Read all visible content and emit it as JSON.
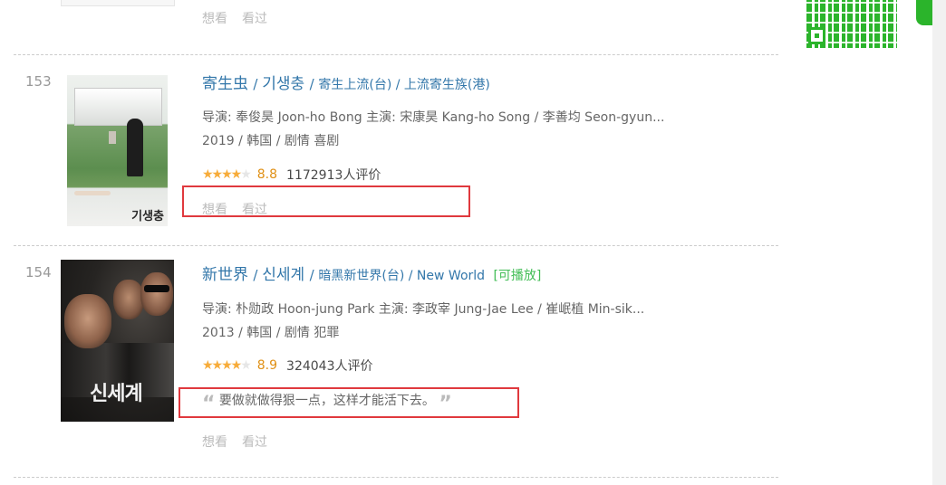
{
  "top_item": {
    "actions": [
      "想看",
      "看过"
    ]
  },
  "movies": [
    {
      "rank": "153",
      "title": "寄生虫",
      "original_title": "기생충",
      "other_titles": "寄生上流(台) / 上流寄生族(港)",
      "director_cast": "导演: 奉俊昊 Joon-ho Bong   主演: 宋康昊 Kang-ho Song / 李善均 Seon-gyun...",
      "year_region_genre": "2019 / 韩国 / 剧情 喜剧",
      "rating": "8.8",
      "rating_fraction": 0.88,
      "votes": "1172913人评价",
      "poster_title": "기생충",
      "actions": [
        "想看",
        "看过"
      ]
    },
    {
      "rank": "154",
      "title": "新世界",
      "original_title": "신세계",
      "other_titles": "暗黑新世界(台) / New World",
      "playable": "[可播放]",
      "director_cast": "导演: 朴勋政 Hoon-jung Park   主演: 李政宰 Jung-Jae Lee / 崔岷植 Min-sik...",
      "year_region_genre": "2013 / 韩国 / 剧情 犯罪",
      "rating": "8.9",
      "rating_fraction": 0.89,
      "votes": "324043人评价",
      "quote": "要做就做得狠一点，这样才能活下去。",
      "poster_title": "신세계",
      "actions": [
        "想看",
        "看过"
      ]
    }
  ],
  "colors": {
    "link": "#3377aa",
    "rating": "#e09015",
    "star": "#f7ac3a",
    "playable": "#42bd56",
    "highlight_box": "#e0393e"
  }
}
